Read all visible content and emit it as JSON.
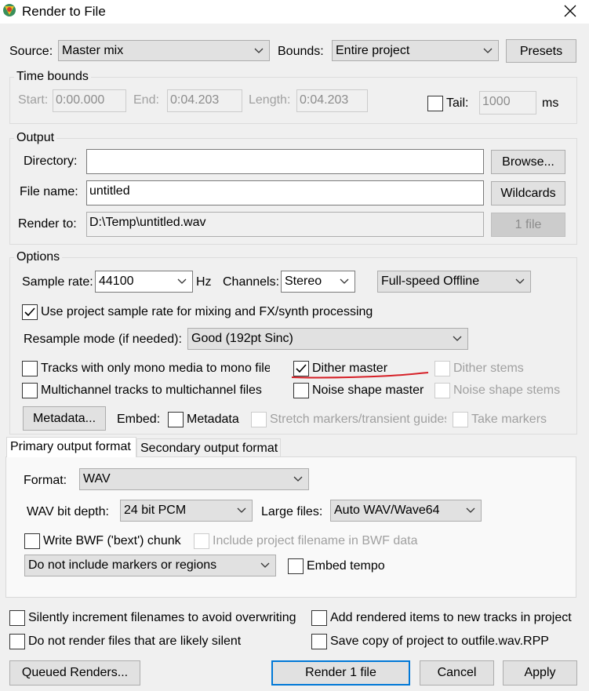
{
  "window": {
    "title": "Render to File"
  },
  "source": {
    "label": "Source:",
    "value": "Master mix"
  },
  "bounds": {
    "label": "Bounds:",
    "value": "Entire project"
  },
  "presets_label": "Presets",
  "time_bounds": {
    "group_label": "Time bounds",
    "start_label": "Start:",
    "start_value": "0:00.000",
    "end_label": "End:",
    "end_value": "0:04.203",
    "length_label": "Length:",
    "length_value": "0:04.203",
    "tail_label": "Tail:",
    "tail_value": "1000",
    "tail_unit": "ms",
    "tail_checked": false
  },
  "output": {
    "group_label": "Output",
    "directory_label": "Directory:",
    "directory_value": "",
    "browse_label": "Browse...",
    "filename_label": "File name:",
    "filename_value": "untitled",
    "wildcards_label": "Wildcards",
    "render_to_label": "Render to:",
    "render_to_value": "D:\\Temp\\untitled.wav",
    "file_count_label": "1 file"
  },
  "options": {
    "group_label": "Options",
    "sample_rate_label": "Sample rate:",
    "sample_rate_value": "44100",
    "hz_label": "Hz",
    "channels_label": "Channels:",
    "channels_value": "Stereo",
    "speed_value": "Full-speed Offline",
    "use_project_rate_label": "Use project sample rate for mixing and FX/synth processing",
    "resample_label": "Resample mode (if needed):",
    "resample_value": "Good (192pt Sinc)",
    "mono_tracks_label": "Tracks with only mono media to mono files",
    "multichannel_label": "Multichannel tracks to multichannel files",
    "dither_master_label": "Dither master",
    "noise_shape_master_label": "Noise shape master",
    "dither_stems_label": "Dither stems",
    "noise_shape_stems_label": "Noise shape stems",
    "metadata_button_label": "Metadata...",
    "embed_label": "Embed:",
    "embed_metadata_label": "Metadata",
    "stretch_markers_label": "Stretch markers/transient guides",
    "take_markers_label": "Take markers"
  },
  "tabs": {
    "primary": "Primary output format",
    "secondary": "Secondary output format"
  },
  "format": {
    "format_label": "Format:",
    "format_value": "WAV",
    "bit_depth_label": "WAV bit depth:",
    "bit_depth_value": "24 bit PCM",
    "large_files_label": "Large files:",
    "large_files_value": "Auto WAV/Wave64",
    "bwf_label": "Write BWF ('bext') chunk",
    "include_filename_label": "Include project filename in BWF data",
    "markers_value": "Do not include markers or regions",
    "embed_tempo_label": "Embed tempo"
  },
  "bottom": {
    "silent_increment_label": "Silently increment filenames to avoid overwriting",
    "add_rendered_label": "Add rendered items to new tracks in project",
    "no_silent_label": "Do not render files that are likely silent",
    "save_copy_label": "Save copy of project to outfile.wav.RPP"
  },
  "buttons": {
    "queued": "Queued Renders...",
    "render": "Render 1 file",
    "cancel": "Cancel",
    "apply": "Apply"
  },
  "colors": {
    "accent": "#0078d7",
    "annotation_red": "#d62027"
  },
  "icons": {
    "app": "reaper-logo-icon",
    "close": "close-icon",
    "dropdown": "chevron-down-icon",
    "check": "checkmark-icon"
  }
}
